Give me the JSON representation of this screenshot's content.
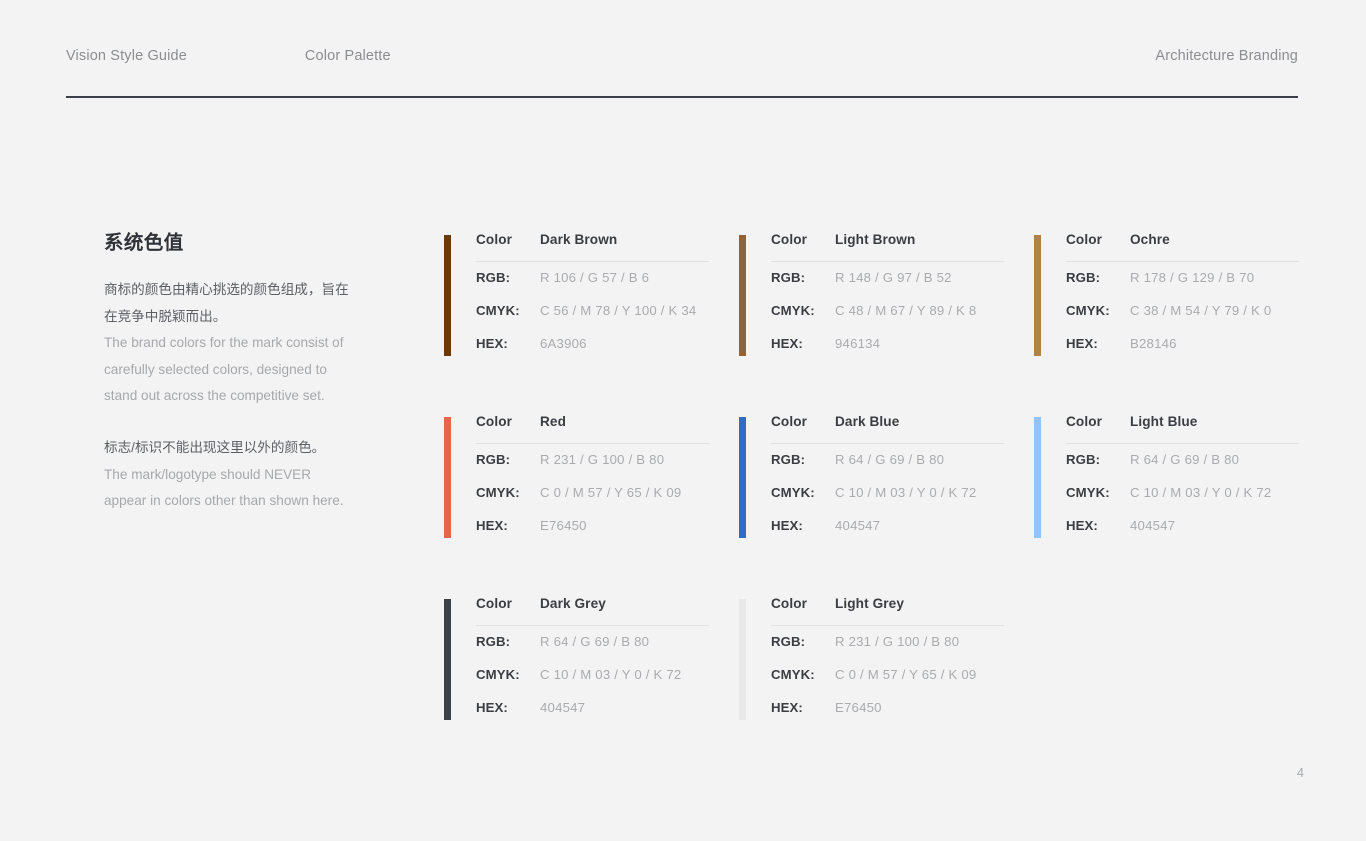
{
  "header": {
    "left_items": [
      "Vision Style Guide",
      "Color Palette"
    ],
    "right_label": "Architecture Branding"
  },
  "intro": {
    "title": "系统色值",
    "cn_paragraph_1": "商标的颜色由精心挑选的颜色组成，旨在在竞争中脱颖而出。",
    "en_paragraph_1": "The brand colors for the mark consist of carefully selected colors, designed to stand out across the competitive set.",
    "cn_paragraph_2": "标志/标识不能出现这里以外的颜色。",
    "en_paragraph_2": "The mark/logotype should NEVER appear in colors other than shown here."
  },
  "labels": {
    "color": "Color",
    "rgb": "RGB:",
    "cmyk": "CMYK:",
    "hex": "HEX:"
  },
  "swatches": [
    {
      "name": "Dark Brown",
      "bar_color": "#6A3906",
      "rgb": "R 106 / G 57 / B 6",
      "cmyk": "C 56 / M 78 / Y 100 / K 34",
      "hex": "6A3906"
    },
    {
      "name": "Light Brown",
      "bar_color": "#946134",
      "rgb": "R 148 / G 97 / B 52",
      "cmyk": "C 48 / M 67 / Y 89 / K 8",
      "hex": "946134"
    },
    {
      "name": "Ochre",
      "bar_color": "#B28146",
      "rgb": "R 178 / G 129 / B 70",
      "cmyk": "C 38 / M 54 / Y 79 / K 0",
      "hex": "B28146"
    },
    {
      "name": "Red",
      "bar_color": "#E76450",
      "rgb": "R 231 / G 100 / B 80",
      "cmyk": "C 0 / M 57 / Y 65 / K 09",
      "hex": "E76450"
    },
    {
      "name": "Dark Blue",
      "bar_color": "#2F6CC4",
      "rgb": "R 64 / G 69 / B 80",
      "cmyk": "C 10 / M 03 / Y 0 / K 72",
      "hex": "404547"
    },
    {
      "name": "Light Blue",
      "bar_color": "#8EC4F7",
      "rgb": "R 64 / G 69 / B 80",
      "cmyk": "C 10 / M 03 / Y 0 / K 72",
      "hex": "404547"
    },
    {
      "name": "Dark Grey",
      "bar_color": "#3C4149",
      "rgb": "R 64 / G 69 / B 80",
      "cmyk": "C 10 / M 03 / Y 0 / K 72",
      "hex": "404547"
    },
    {
      "name": "Light Grey",
      "bar_color": "#E8E8E8",
      "rgb": "R 231 / G 100 / B 80",
      "cmyk": "C 0 / M 57 / Y 65 / K 09",
      "hex": "E76450"
    }
  ],
  "footer": {
    "page_number": "4"
  }
}
